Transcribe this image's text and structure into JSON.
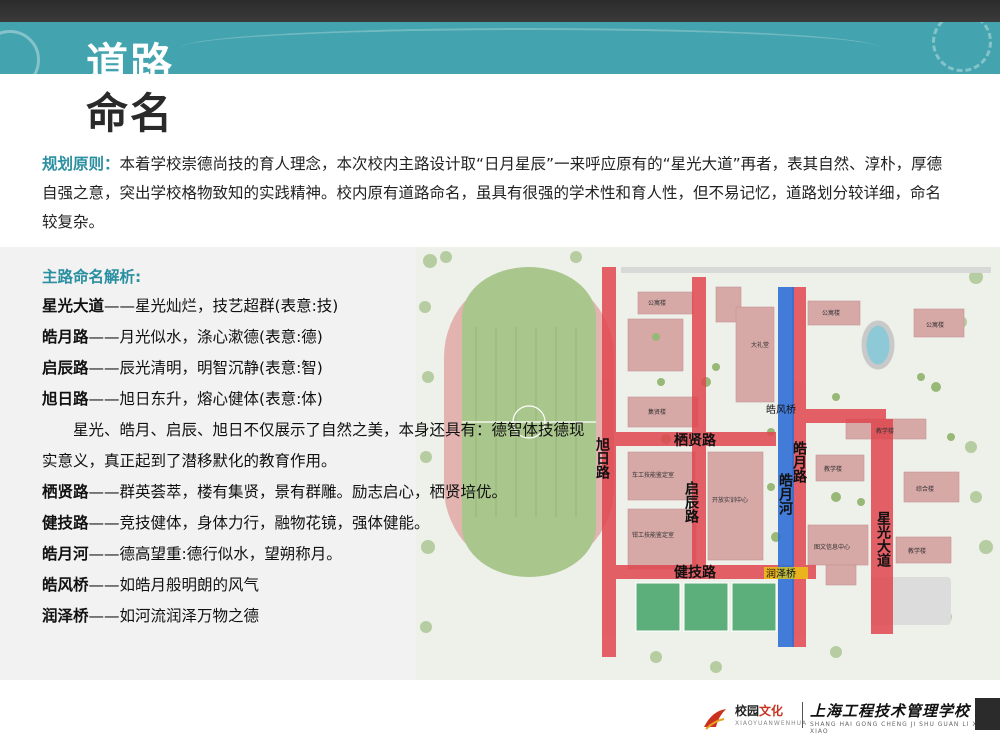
{
  "title": {
    "line1": "道路",
    "line2": "命名"
  },
  "principle": {
    "label": "规划原则：",
    "text": "本着学校崇德尚技的育人理念，本次校内主路设计取“日月星辰”一来呼应原有的“星光大道”再者，表其自然、淳朴，厚德自强之意，突出学校格物致知的实践精神。校内原有道路命名，虽具有很强的学术性和育人性，但不易记忆，道路划分较详细，命名较复杂。"
  },
  "analysis": {
    "heading": "主路命名解析:",
    "items": [
      {
        "name": "星光大道",
        "dash": "——",
        "desc": "星光灿烂，技艺超群(表意:技)"
      },
      {
        "name": "皓月路",
        "dash": "——",
        "desc": "月光似水，涤心漱德(表意:德)"
      },
      {
        "name": "启辰路",
        "dash": "——",
        "desc": "辰光清明，明智沉静(表意:智)"
      },
      {
        "name": "旭日路",
        "dash": "——",
        "desc": "旭日东升，熔心健体(表意:体)"
      }
    ],
    "paragraph": "星光、皓月、启辰、旭日不仅展示了自然之美，本身还具有：德智体技德现实意义，真正起到了潜移默化的教育作用。",
    "items2": [
      {
        "name": "栖贤路",
        "dash": "——",
        "desc": "群英荟萃，楼有集贤，景有群雕。励志启心，栖贤培优。"
      },
      {
        "name": "健技路",
        "dash": "——",
        "desc": "竞技健体，身体力行，融物花镜，强体健能。"
      },
      {
        "name": "皓月河",
        "dash": "——",
        "desc": "德高望重:德行似水，望朔称月。"
      },
      {
        "name": "皓风桥",
        "dash": "——",
        "desc": "如皓月般明朗的风气"
      },
      {
        "name": "润泽桥",
        "dash": "——",
        "desc": "如河流润泽万物之德"
      }
    ]
  },
  "map": {
    "roads": {
      "xuri": "旭日路",
      "qixian": "栖贤路",
      "qichen": "启辰路",
      "haoyue_road": "皓月路",
      "haoyue_river": "皓月河",
      "xingguang": "星光大道",
      "jianji": "健技路",
      "haofeng_bridge": "皓风桥",
      "runze_bridge": "润泽桥"
    },
    "buildings": {
      "office1": "公寓楼",
      "office2": "公寓楼",
      "office3": "公寓楼",
      "auditorium": "大礼堂",
      "building_a": "集贤楼",
      "training1": "车工技能鉴定室",
      "training2": "钳工技能鉴定室",
      "center": "开放实训中心",
      "teaching1": "教学楼",
      "teaching2": "教学楼",
      "teaching3": "教学楼",
      "complex": "综合楼",
      "library": "图文信息中心"
    },
    "colors": {
      "road": "#e0464f",
      "river": "#2f6fd6",
      "bridge_label": "#f0d800"
    }
  },
  "footer": {
    "brand_a": "校园",
    "brand_b": "文化",
    "brand_sub": "XIAOYUANWENHUA",
    "school": "上海工程技术管理学校",
    "school_sub": "SHANG HAI GONG CHENG JI SHU GUAN LI XUE XIAO"
  }
}
